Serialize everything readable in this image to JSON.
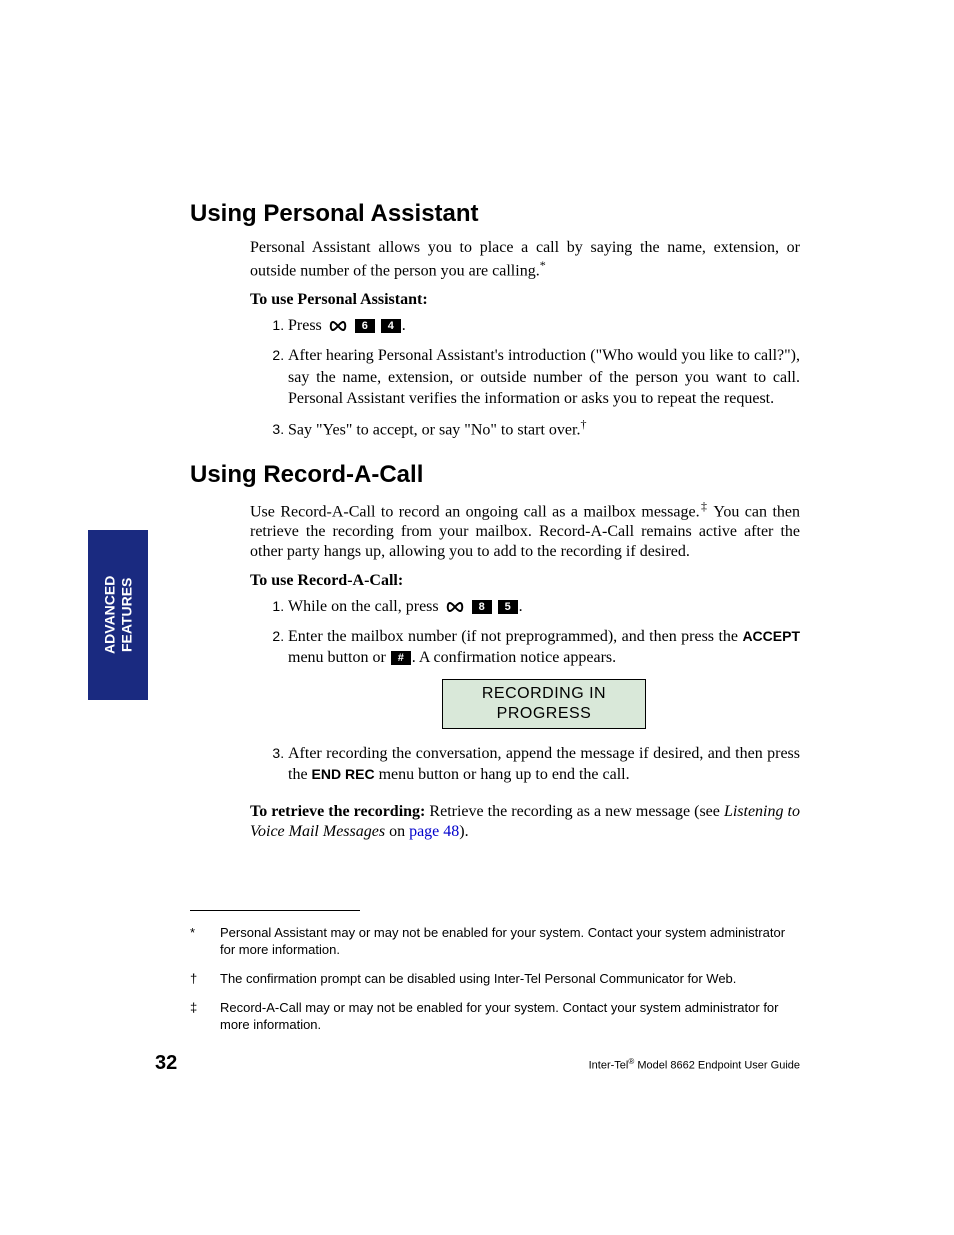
{
  "sideTab": {
    "line1": "ADVANCED",
    "line2": "FEATURES"
  },
  "section1": {
    "heading": "Using Personal Assistant",
    "intro": "Personal Assistant allows you to place a call by saying the name, extension, or outside number of the person you are calling.",
    "introMark": "*",
    "toUse": "To use Personal Assistant:",
    "step1_pre": "Press ",
    "step1_key1": "6",
    "step1_key2": "4",
    "step1_post": ".",
    "step2": "After hearing Personal Assistant's introduction (\"Who would you like to call?\"), say the name, extension, or outside number of the person you want to call. Personal Assistant verifies the information or asks you to repeat the request.",
    "step3_txt": "Say \"Yes\" to accept, or say \"No\" to start over.",
    "step3_mark": "†"
  },
  "section2": {
    "heading": "Using Record-A-Call",
    "intro_a": "Use Record-A-Call to record an ongoing call as a mailbox message.",
    "intro_mark": "‡",
    "intro_b": " You can then retrieve the recording from your mailbox. Record-A-Call remains active after the other party hangs up, allowing you to add to the recording if desired.",
    "toUse": "To use Record-A-Call:",
    "s1_pre": "While on the call, press ",
    "s1_key1": "8",
    "s1_key2": "5",
    "s1_post": ".",
    "s2_a": "Enter the mailbox number (if not preprogrammed), and then press the ",
    "s2_accept": "ACCEPT",
    "s2_b": " menu button or ",
    "s2_hash": "#",
    "s2_c": ". A confirmation notice appears.",
    "display_l1": "RECORDING IN",
    "display_l2": "PROGRESS",
    "s3_a": "After recording the conversation, append the message if desired, and then press the ",
    "s3_end": "END REC",
    "s3_b": " menu button or hang up to end the call.",
    "retrieve_bold": "To retrieve the recording:",
    "retrieve_a": " Retrieve the recording as a new message (see ",
    "retrieve_it": "Listening to Voice Mail Messages",
    "retrieve_b": " on ",
    "retrieve_link": "page 48",
    "retrieve_c": ")."
  },
  "footnotes": {
    "f1_sym": "*",
    "f1_txt": "Personal Assistant may or may not be enabled for your system. Contact your system administrator for more information.",
    "f2_sym": "†",
    "f2_txt": "The confirmation prompt can be disabled using Inter-Tel Personal Communicator for Web.",
    "f3_sym": "‡",
    "f3_txt": "Record-A-Call may or may not be enabled for your system. Contact your system administrator for more information."
  },
  "footer": {
    "pageNum": "32",
    "right_a": "Inter-Tel",
    "right_reg": "®",
    "right_b": " Model 8662 Endpoint User Guide"
  }
}
